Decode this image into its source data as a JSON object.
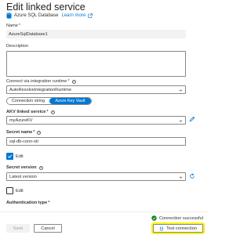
{
  "header": {
    "title": "Edit linked service",
    "subtitle": "Azure SQL Database",
    "learn_more": "Learn more"
  },
  "form": {
    "name_label": "Name",
    "name_required": "*",
    "name_value": "AzureSqlDatabase1",
    "description_label": "Description",
    "description_value": "",
    "runtime_label": "Connect via integration runtime",
    "runtime_required": "*",
    "runtime_value": "AutoResolveIntegrationRuntime",
    "toggle_connection_string": "Connection string",
    "toggle_key_vault": "Azure Key Vault",
    "toggle_selected": "Azure Key Vault",
    "akv_label": "AKV linked service",
    "akv_required": "*",
    "akv_value": "myAzureKV",
    "secret_name_label": "Secret name",
    "secret_name_required": "*",
    "secret_name_value": "sql-db-conn-str",
    "edit_checkbox_1_label": "Edit",
    "edit_checkbox_1_checked": true,
    "secret_version_label": "Secret version",
    "secret_version_value": "Latest version",
    "edit_checkbox_2_label": "Edit",
    "edit_checkbox_2_checked": false,
    "auth_type_label": "Authentication type",
    "auth_type_required": "*"
  },
  "footer": {
    "status_text": "Connection successful",
    "create_label": "Save",
    "cancel_label": "Cancel",
    "test_label": "Test connection"
  },
  "colors": {
    "accent": "#0078d4",
    "success": "#107c10",
    "highlight": "#fff200",
    "required": "#a4262c"
  },
  "icons": {
    "database": "sql-database-icon",
    "external": "external-link-icon",
    "chevron": "chevron-down-icon",
    "pencil": "pencil-icon",
    "refresh": "refresh-icon",
    "success": "checkmark-circle-icon",
    "test": "plug-icon"
  }
}
